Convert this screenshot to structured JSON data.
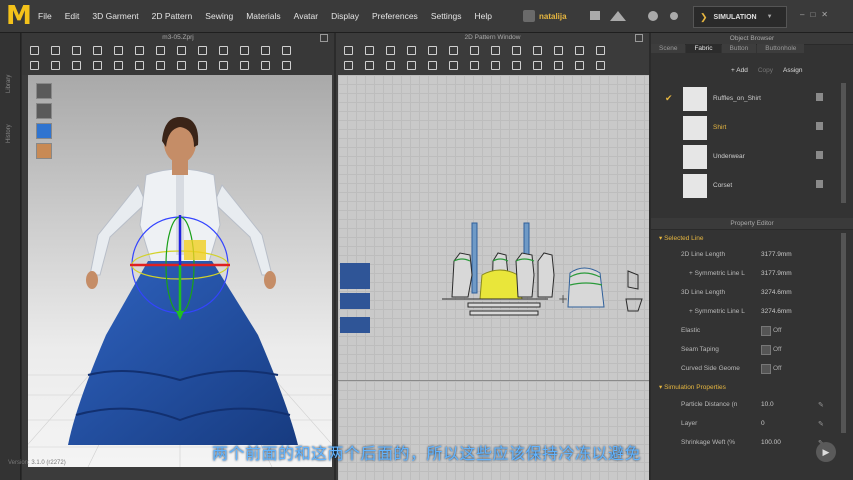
{
  "app": {
    "logo": "M"
  },
  "menu": [
    "File",
    "Edit",
    "3D Garment",
    "2D Pattern",
    "Sewing",
    "Materials",
    "Avatar",
    "Display",
    "Preferences",
    "Settings",
    "Help"
  ],
  "user": {
    "name": "natalija"
  },
  "simulation": {
    "label": "SIMULATION"
  },
  "left_tabs": [
    "Library",
    "History"
  ],
  "panel3d": {
    "title": "m3-05.Zprj"
  },
  "panel2d": {
    "title": "2D Pattern Window"
  },
  "object_browser": {
    "title": "Object Browser",
    "tabs": [
      "Scene",
      "Fabric",
      "Button",
      "Buttonhole"
    ],
    "active_tab": "Fabric",
    "tools": {
      "add": "+ Add",
      "copy": "Copy",
      "assign": "Assign"
    },
    "fabrics": [
      {
        "name": "Ruffles_on_Shirt",
        "checked": true,
        "selected": false
      },
      {
        "name": "Shirt",
        "checked": false,
        "selected": true
      },
      {
        "name": "Underwear",
        "checked": false,
        "selected": false
      },
      {
        "name": "Corset",
        "checked": false,
        "selected": false
      }
    ]
  },
  "property_editor": {
    "title": "Property Editor",
    "section_selected": "Selected Line",
    "rows": [
      {
        "key": "2D Line Length",
        "value": "3177.9mm"
      },
      {
        "key": "+ Symmetric Line L",
        "value": "3177.9mm"
      },
      {
        "key": "3D Line Length",
        "value": "3274.6mm"
      },
      {
        "key": "+ Symmetric Line L",
        "value": "3274.6mm"
      },
      {
        "key": "Elastic",
        "value": "Off"
      },
      {
        "key": "Seam Taping",
        "value": "Off"
      },
      {
        "key": "Curved Side Geome",
        "value": "Off"
      }
    ],
    "section_sim": "Simulation Properties",
    "sim_rows": [
      {
        "key": "Particle Distance (n",
        "value": "10.0"
      },
      {
        "key": "Layer",
        "value": "0"
      },
      {
        "key": "Shrinkage Weft (%",
        "value": "100.00"
      }
    ]
  },
  "version": "Version: 3.1.0 (r2272)",
  "subtitle": "两个前面的和这两个后面的，所以这些应该保持冷冻以避免",
  "colors": {
    "accent": "#e6b640",
    "subtitle": "#62b4ff",
    "dress": "#1f4fa3"
  }
}
